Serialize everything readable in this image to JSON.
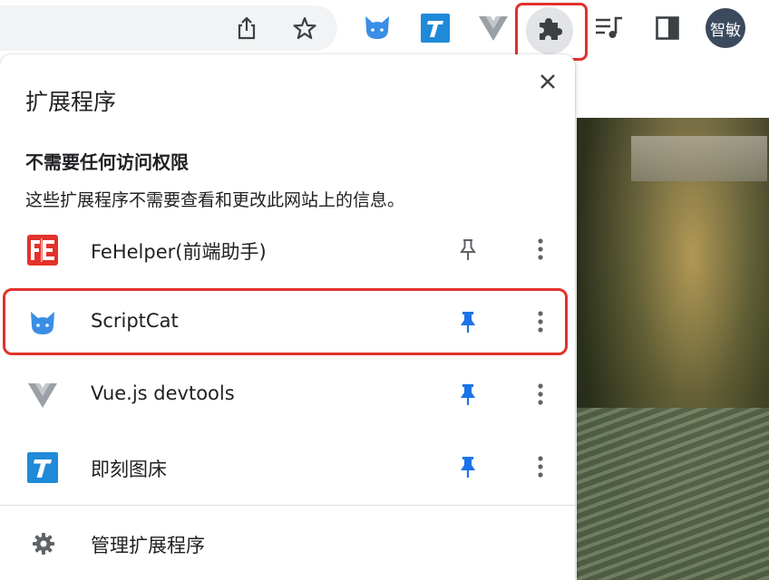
{
  "toolbar": {
    "avatar_text": "智敏",
    "icons": [
      "share-icon",
      "bookmark-star-icon",
      "scriptcat-icon",
      "jike-tuchuang-icon",
      "vue-devtools-icon",
      "extensions-puzzle-icon",
      "media-queue-icon",
      "side-panel-icon"
    ]
  },
  "popup": {
    "title": "扩展程序",
    "section_heading": "不需要任何访问权限",
    "section_desc": "这些扩展程序不需要查看和更改此网站上的信息。",
    "extensions": [
      {
        "name": "FeHelper(前端助手)",
        "pinned": false
      },
      {
        "name": "ScriptCat",
        "pinned": true
      },
      {
        "name": "Vue.js devtools",
        "pinned": true
      },
      {
        "name": "即刻图床",
        "pinned": true
      }
    ],
    "manage_label": "管理扩展程序"
  },
  "colors": {
    "pin_active": "#1a73e8",
    "pin_inactive": "#5f6368",
    "highlight": "#e0322b",
    "scriptcat_blue": "#3a8ee6",
    "fehelper_red": "#e2322b",
    "jike_blue": "#1f8ad8"
  }
}
